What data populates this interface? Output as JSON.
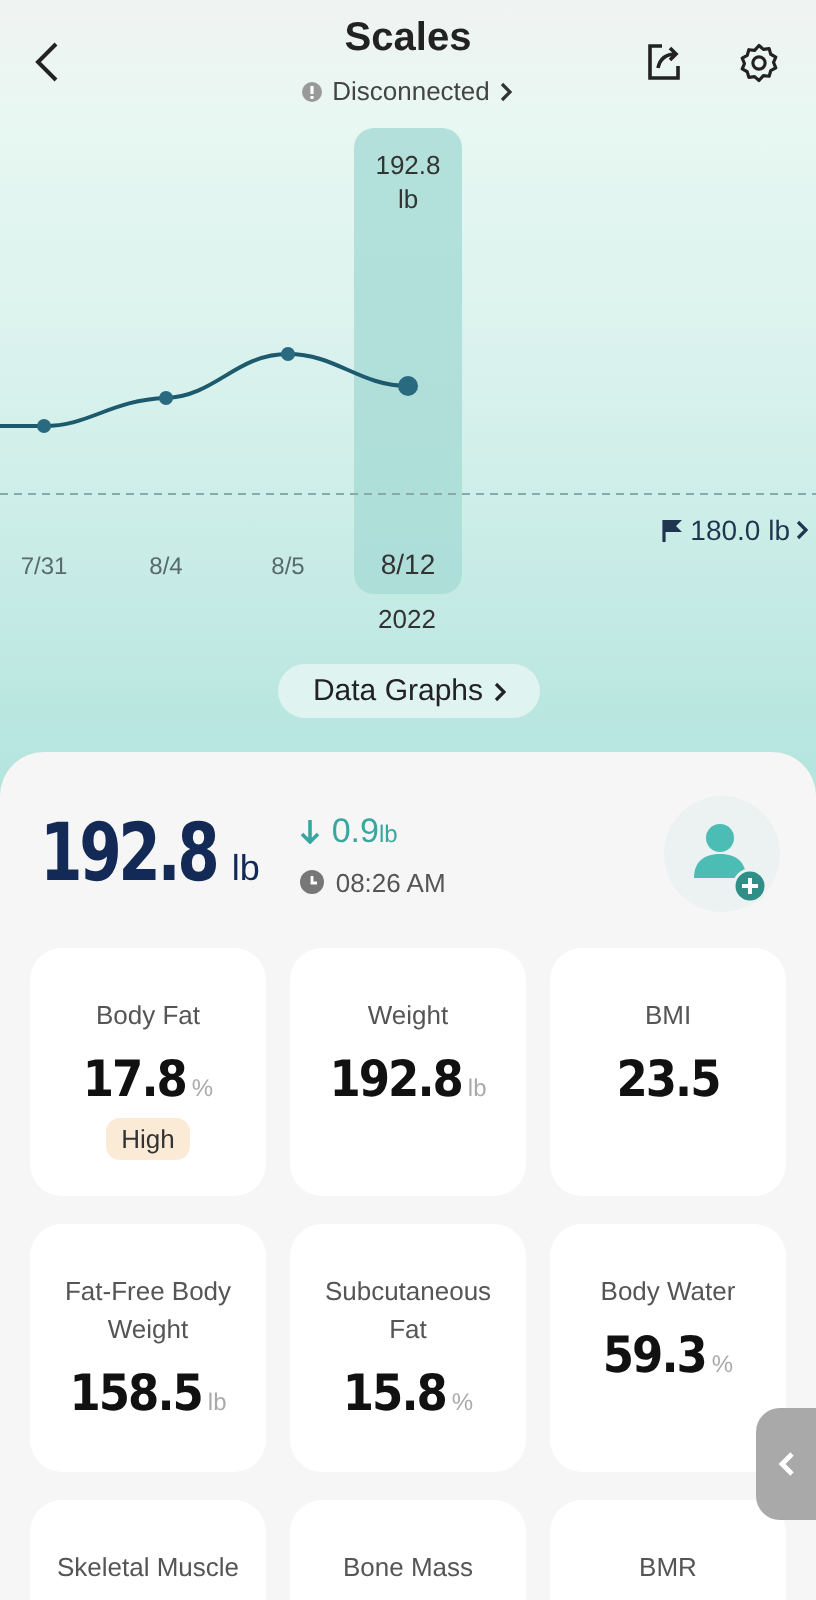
{
  "header": {
    "title": "Scales",
    "status": "Disconnected"
  },
  "chart": {
    "selected_reading": "192.8",
    "selected_unit": "lb",
    "year": "2022",
    "goal": "180.0 lb",
    "dates": [
      {
        "label": "7/31",
        "selected": false
      },
      {
        "label": "8/4",
        "selected": false
      },
      {
        "label": "8/5",
        "selected": false
      },
      {
        "label": "8/12",
        "selected": true
      }
    ]
  },
  "data_graphs_button": "Data Graphs",
  "summary": {
    "weight": "192.8",
    "unit": "lb",
    "change": "0.9",
    "change_unit": "lb",
    "time": "08:26 AM"
  },
  "metrics": [
    {
      "label": "Body Fat",
      "value": "17.8",
      "unit": "%",
      "badge": "High"
    },
    {
      "label": "Weight",
      "value": "192.8",
      "unit": "lb"
    },
    {
      "label": "BMI",
      "value": "23.5"
    },
    {
      "label": "Fat-Free Body Weight",
      "value": "158.5",
      "unit": "lb"
    },
    {
      "label": "Subcutaneous Fat",
      "value": "15.8",
      "unit": "%"
    },
    {
      "label": "Body Water",
      "value": "59.3",
      "unit": "%"
    },
    {
      "label": "Skeletal Muscle"
    },
    {
      "label": "Bone Mass"
    },
    {
      "label": "BMR"
    }
  ]
}
